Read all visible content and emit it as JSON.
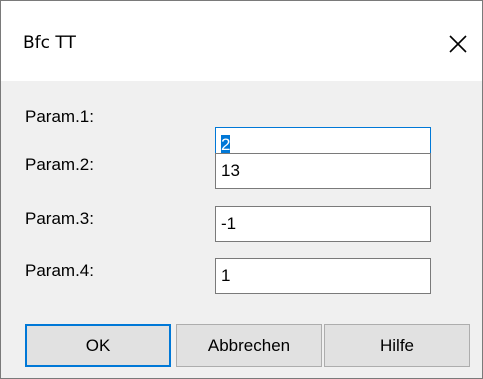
{
  "window": {
    "title": "Bfc TT",
    "close_icon": "close-icon"
  },
  "params": [
    {
      "label": "Param.1:",
      "value": "2"
    },
    {
      "label": "Param.2:",
      "value": "13"
    },
    {
      "label": "Param.3:",
      "value": "-1"
    },
    {
      "label": "Param.4:",
      "value": "1"
    }
  ],
  "buttons": {
    "ok": "OK",
    "cancel": "Abbrechen",
    "help": "Hilfe"
  },
  "colors": {
    "accent": "#0078d7",
    "dialog_bg": "#f0f0f0",
    "button_bg": "#e1e1e1"
  }
}
